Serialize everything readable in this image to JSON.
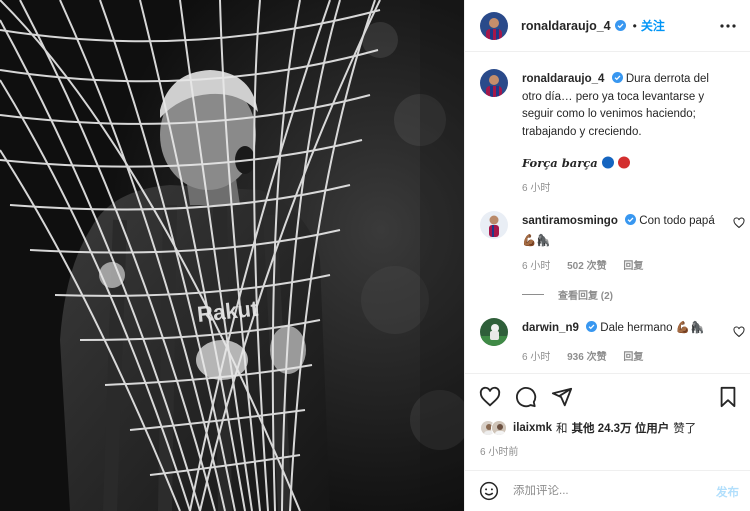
{
  "header": {
    "username": "ronaldaraujo_4",
    "dot": "•",
    "follow_label": "关注"
  },
  "caption": {
    "username": "ronaldaraujo_4",
    "text": "Dura derrota del otro día… pero ya toca levantarse y seguir como lo venimos haciendo; trabajando y creciendo.",
    "signature": "Força barça",
    "time": "6 小时"
  },
  "comments": [
    {
      "username": "santiramosmingo",
      "text": "Con todo papá",
      "emojis": "💪🏾🦍",
      "time": "6 小时",
      "likes": "502 次赞",
      "reply_label": "回复",
      "view_replies": "查看回复 (2)"
    },
    {
      "username": "darwin_n9",
      "text": "Dale hermano",
      "emojis": "💪🏾🦍",
      "time": "6 小时",
      "likes": "936 次赞",
      "reply_label": "回复"
    }
  ],
  "likes_summary": {
    "user": "ilaixmk",
    "and": "和",
    "others": "其他 24.3万 位用户",
    "suffix": "赞了"
  },
  "post_time": "6 小时前",
  "add_comment": {
    "placeholder": "添加评论...",
    "post_label": "发布"
  },
  "icons": {
    "more": "more-horizontal-icon",
    "like": "heart-icon",
    "comment": "comment-bubble-icon",
    "share": "paper-plane-icon",
    "save": "bookmark-icon",
    "emoji": "smiley-icon",
    "verified": "verified-badge-icon"
  },
  "colors": {
    "accent": "#0095f6",
    "post_disabled": "#b2dffc",
    "muted": "#8e8e8e",
    "verified": "#3897f0",
    "barca_blue": "#1565c0",
    "barca_red": "#d32f2f"
  }
}
